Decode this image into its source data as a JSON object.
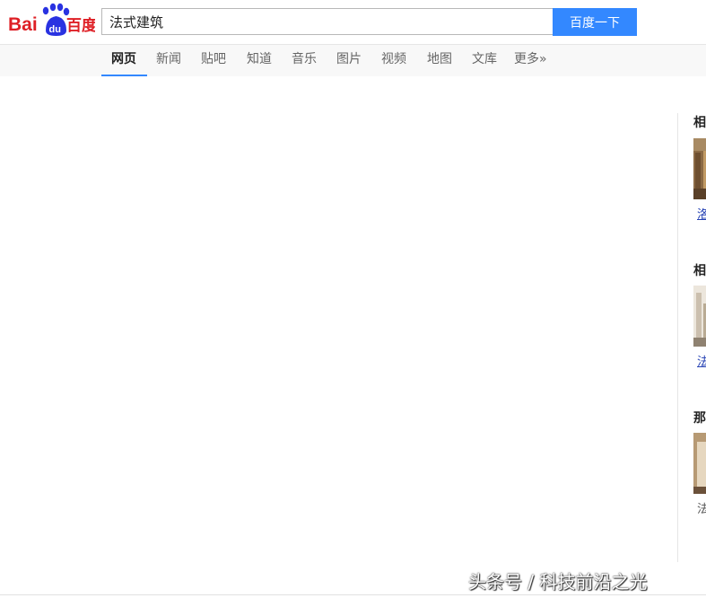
{
  "logo": {
    "latin": "Bai",
    "paw_text": "du",
    "cn": "百度"
  },
  "search": {
    "value": "法式建筑",
    "button_label": "百度一下"
  },
  "nav": {
    "items": [
      {
        "label": "网页",
        "active": true
      },
      {
        "label": "新闻"
      },
      {
        "label": "贴吧"
      },
      {
        "label": "知道"
      },
      {
        "label": "音乐"
      },
      {
        "label": "图片"
      },
      {
        "label": "视频"
      },
      {
        "label": "地图"
      },
      {
        "label": "文库"
      },
      {
        "label": "更多»"
      }
    ]
  },
  "right_sidebar": {
    "sections": [
      {
        "title": "相",
        "link": "洛"
      },
      {
        "title": "相",
        "link": "法"
      },
      {
        "title": "那",
        "link": "法"
      }
    ]
  },
  "watermark": "头条号 / 科技前沿之光",
  "colors": {
    "accent": "#3388ff",
    "brand_red": "#de1f25",
    "brand_blue": "#2932e1",
    "link": "#2440b3"
  }
}
